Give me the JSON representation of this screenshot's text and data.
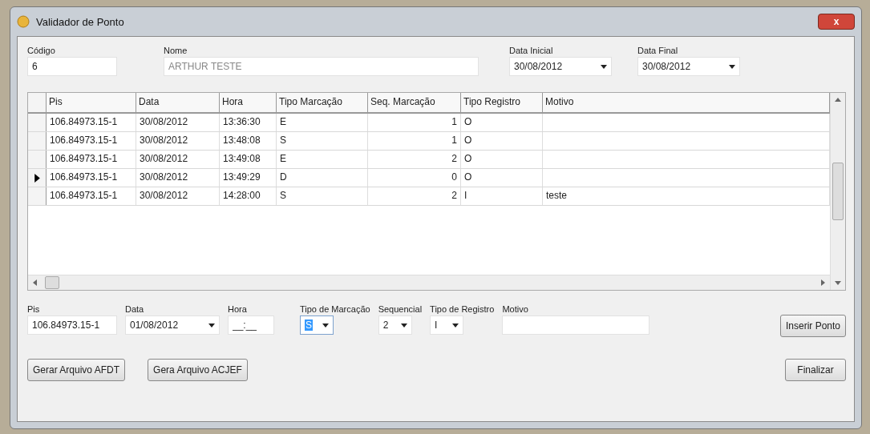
{
  "window": {
    "title": "Validador de Ponto",
    "close": "x"
  },
  "filters": {
    "codigo": {
      "label": "Código",
      "value": "6"
    },
    "nome": {
      "label": "Nome",
      "value": "ARTHUR TESTE",
      "disabled": true
    },
    "data_inicial": {
      "label": "Data Inicial",
      "value": "30/08/2012"
    },
    "data_final": {
      "label": "Data Final",
      "value": "30/08/2012"
    }
  },
  "table": {
    "columns": [
      "Pis",
      "Data",
      "Hora",
      "Tipo Marcação",
      "Seq. Marcação",
      "Tipo Registro",
      "Motivo"
    ],
    "rows": [
      {
        "selected": false,
        "cells": [
          "106.84973.15-1",
          "30/08/2012",
          "13:36:30",
          "E",
          "1",
          "O",
          ""
        ]
      },
      {
        "selected": false,
        "cells": [
          "106.84973.15-1",
          "30/08/2012",
          "13:48:08",
          "S",
          "1",
          "O",
          ""
        ]
      },
      {
        "selected": false,
        "cells": [
          "106.84973.15-1",
          "30/08/2012",
          "13:49:08",
          "E",
          "2",
          "O",
          ""
        ]
      },
      {
        "selected": true,
        "cells": [
          "106.84973.15-1",
          "30/08/2012",
          "13:49:29",
          "D",
          "0",
          "O",
          ""
        ]
      },
      {
        "selected": false,
        "cells": [
          "106.84973.15-1",
          "30/08/2012",
          "14:28:00",
          "S",
          "2",
          "I",
          "teste"
        ]
      }
    ]
  },
  "entry": [
    {
      "kind": "text",
      "label": "Pis",
      "value": "106.84973.15-1"
    },
    {
      "kind": "date",
      "label": "Data",
      "value": "01/08/2012"
    },
    {
      "kind": "text",
      "label": "Hora",
      "value": "__:__"
    },
    {
      "kind": "select",
      "label": "Tipo de Marcação",
      "value": "S",
      "focused": true
    },
    {
      "kind": "select",
      "label": "Sequencial",
      "value": "2",
      "focused": false
    },
    {
      "kind": "select",
      "label": "Tipo de Registro",
      "value": "I",
      "focused": false
    },
    {
      "kind": "text",
      "label": "Motivo"
    }
  ],
  "insert_button": "Inserir Ponto",
  "buttons": [
    "Gerar Arquivo AFDT",
    "Gera Arquivo ACJEF"
  ],
  "finish_button": "Finalizar"
}
